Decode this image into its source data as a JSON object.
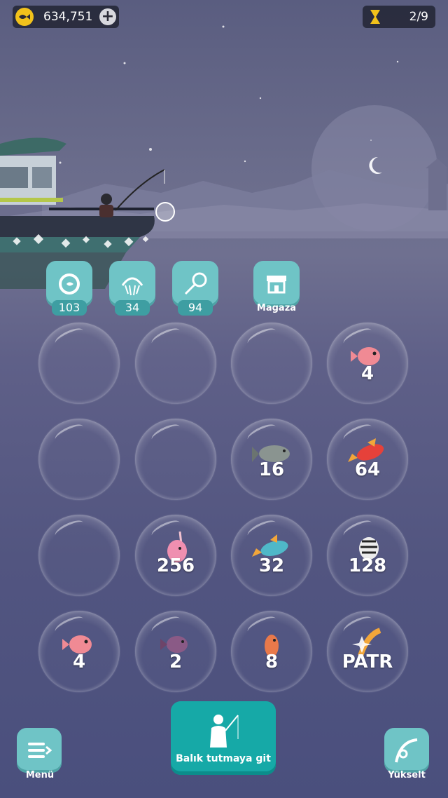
{
  "hud": {
    "coins": "634,751",
    "level": "2/9"
  },
  "tools": [
    {
      "name": "recycle",
      "count": "103"
    },
    {
      "name": "net",
      "count": "34"
    },
    {
      "name": "scoop-net",
      "count": "94"
    }
  ],
  "store": {
    "label": "Magaza"
  },
  "grid": [
    {
      "fish": "",
      "label": ""
    },
    {
      "fish": "",
      "label": ""
    },
    {
      "fish": "",
      "label": ""
    },
    {
      "fish": "pink-puffer",
      "label": "4"
    },
    {
      "fish": "",
      "label": ""
    },
    {
      "fish": "",
      "label": ""
    },
    {
      "fish": "grey-fish",
      "label": "16"
    },
    {
      "fish": "red-fish",
      "label": "64"
    },
    {
      "fish": "",
      "label": ""
    },
    {
      "fish": "pink-seahorse",
      "label": "256"
    },
    {
      "fish": "blue-fish",
      "label": "32"
    },
    {
      "fish": "zebra-fish",
      "label": "128"
    },
    {
      "fish": "pink-puffer",
      "label": "4"
    },
    {
      "fish": "purple-fish",
      "label": "2"
    },
    {
      "fish": "orange-seahorse",
      "label": "8"
    },
    {
      "fish": "sparkle-shrimp",
      "label": "PATR"
    }
  ],
  "buttons": {
    "go_fishing": "Balık tutmaya git",
    "menu": "Menü",
    "upgrade": "Yükselt"
  },
  "colors": {
    "teal": "#6fc4c6",
    "go_button": "#16a9a7",
    "coin": "#f2c21b"
  }
}
